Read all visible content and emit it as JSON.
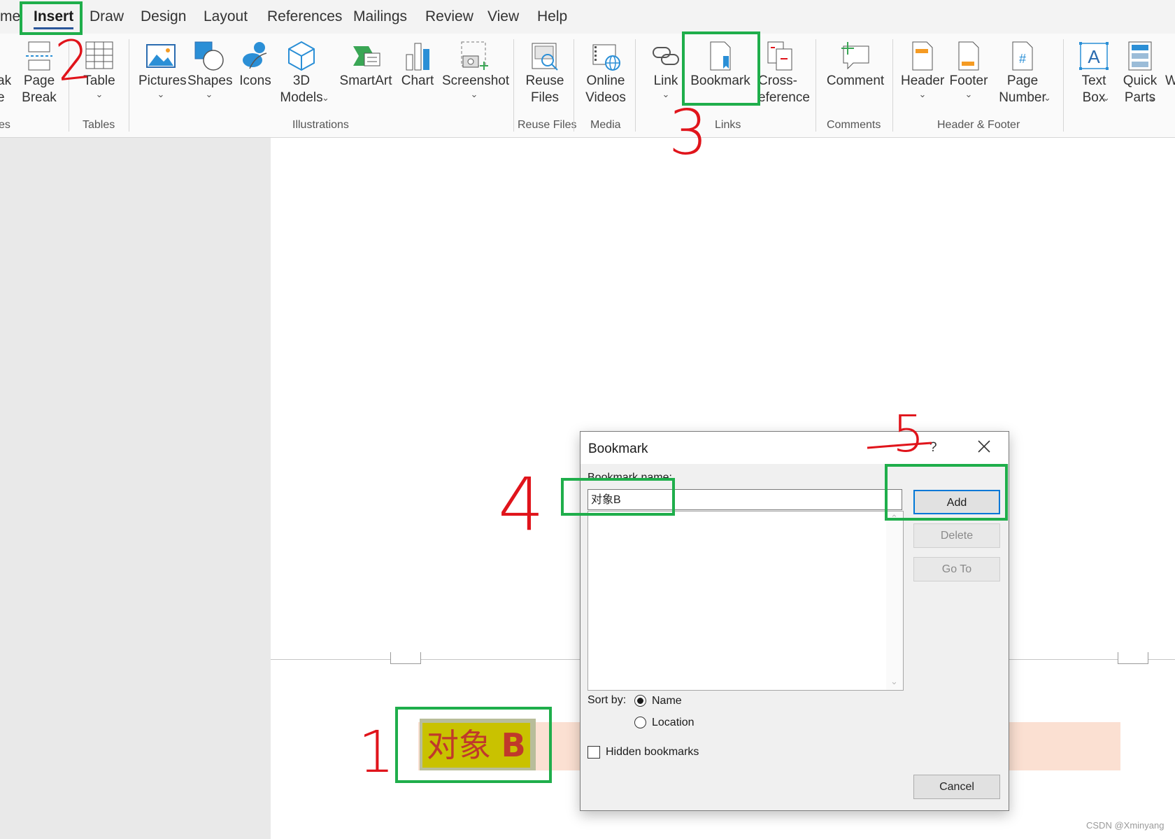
{
  "tabs": [
    "me",
    "Insert",
    "Draw",
    "Design",
    "Layout",
    "References",
    "Mailings",
    "Review",
    "View",
    "Help"
  ],
  "ribbon": {
    "buttons": {
      "cut_left": "ak\ne",
      "page_break": "Page\nBreak",
      "table": "Table",
      "pictures": "Pictures",
      "shapes": "Shapes",
      "icons": "Icons",
      "models3d": "3D\nModels",
      "smartart": "SmartArt",
      "chart": "Chart",
      "screenshot": "Screenshot",
      "reuse_files": "Reuse\nFiles",
      "online_videos": "Online\nVideos",
      "link": "Link",
      "bookmark": "Bookmark",
      "cross_reference": "Cross-\neference",
      "comment": "Comment",
      "header": "Header",
      "footer": "Footer",
      "page_number": "Page\nNumber",
      "text_box": "Text\nBox",
      "quick_parts": "Quick\nParts",
      "cut_right": "W"
    },
    "groups": {
      "pages": "es",
      "tables": "Tables",
      "illustrations": "Illustrations",
      "reuse_files": "Reuse Files",
      "media": "Media",
      "links": "Links",
      "comments": "Comments",
      "header_footer": "Header & Footer"
    }
  },
  "document": {
    "selected_text": "对象",
    "selected_text_b": "B"
  },
  "dialog": {
    "title": "Bookmark",
    "help": "?",
    "name_label": "Bookmark name:",
    "name_value": "对象B",
    "add": "Add",
    "delete": "Delete",
    "goto": "Go To",
    "sort_by": "Sort by:",
    "sort_name": "Name",
    "sort_location": "Location",
    "hidden": "Hidden bookmarks",
    "cancel": "Cancel"
  },
  "annotations": [
    "1",
    "2",
    "3",
    "4",
    "5"
  ],
  "watermark": "CSDN @Xminyang",
  "colors": {
    "highlight_box": "#1fae4b",
    "annotation": "#e0141b",
    "accent": "#2b579a"
  }
}
